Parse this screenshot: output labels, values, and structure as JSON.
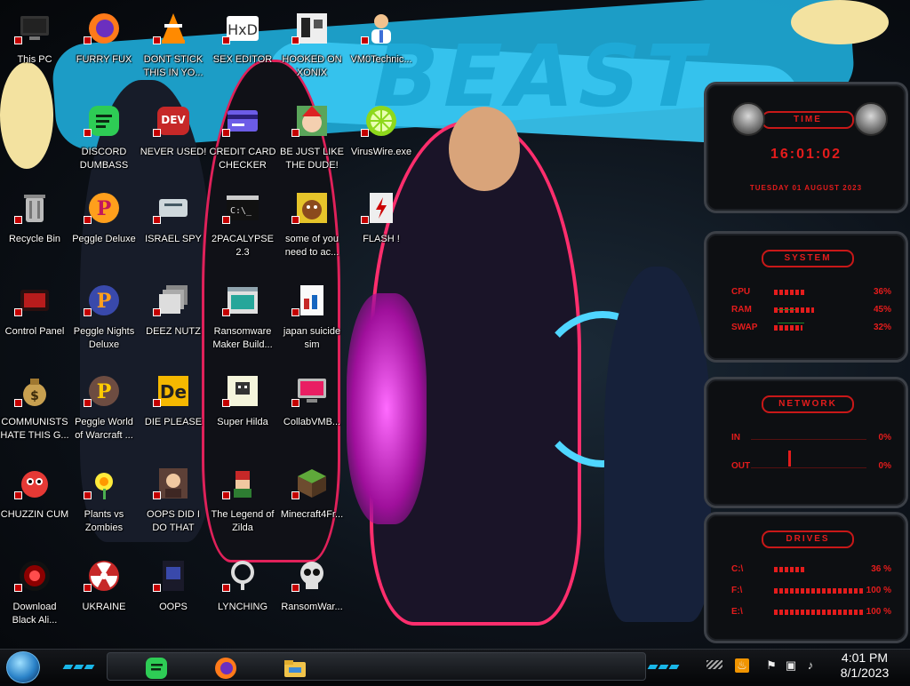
{
  "wallpaper": {
    "title": "BEAST"
  },
  "desktop": {
    "icons": [
      {
        "label": "This PC",
        "icon": "computer-icon"
      },
      {
        "label": "FURRY FUX",
        "icon": "firefox-icon"
      },
      {
        "label": "DONT STICK THIS IN YO...",
        "icon": "vlc-cone-icon"
      },
      {
        "label": "SEX EDITOR",
        "icon": "hex-editor-icon"
      },
      {
        "label": "HOOKED ON XONIX",
        "icon": "xonix-game-icon"
      },
      {
        "label": "VM0Technic...",
        "icon": "doctor-person-icon"
      },
      {
        "label": "DISCORD DUMBASS",
        "icon": "green-chat-icon"
      },
      {
        "label": "NEVER USED!",
        "icon": "dev-cpp-icon"
      },
      {
        "label": "CREDIT CARD CHECKER",
        "icon": "credit-card-icon"
      },
      {
        "label": "BE JUST LIKE THE DUDE!",
        "icon": "santa-face-icon"
      },
      {
        "label": "VirusWire.exe",
        "icon": "lime-slice-icon"
      },
      {
        "label": "Recycle Bin",
        "icon": "recycle-bin-icon"
      },
      {
        "label": "Peggle Deluxe",
        "icon": "peggle-icon"
      },
      {
        "label": "ISRAEL SPY",
        "icon": "card-reader-icon"
      },
      {
        "label": "2PACALYPSE 2.3",
        "icon": "terminal-window-icon"
      },
      {
        "label": "some of you need to ac...",
        "icon": "beaver-icon"
      },
      {
        "label": "FLASH !",
        "icon": "flash-document-icon"
      },
      {
        "label": "Control Panel",
        "icon": "control-panel-icon"
      },
      {
        "label": "Peggle Nights Deluxe",
        "icon": "peggle-nights-icon"
      },
      {
        "label": "DEEZ NUTZ",
        "icon": "stacked-windows-icon"
      },
      {
        "label": "Ransomware Maker Build...",
        "icon": "app-window-icon"
      },
      {
        "label": "japan suicide sim",
        "icon": "installer-document-icon"
      },
      {
        "label": "COMMUNISTS HATE THIS G...",
        "icon": "money-bag-icon"
      },
      {
        "label": "Peggle World of Warcraft ...",
        "icon": "peggle-wow-icon"
      },
      {
        "label": "DIE PLEASE",
        "icon": "de-letters-icon"
      },
      {
        "label": "Super Hilda",
        "icon": "pixel-character-icon"
      },
      {
        "label": "CollabVMB...",
        "icon": "monitor-app-icon"
      },
      {
        "label": "CHUZZIN CUM",
        "icon": "red-chuzzle-icon"
      },
      {
        "label": "Plants vs Zombies",
        "icon": "flower-icon"
      },
      {
        "label": "OOPS DID I DO THAT",
        "icon": "portrait-painting-icon"
      },
      {
        "label": "The Legend of Zilda",
        "icon": "pixel-hero-icon"
      },
      {
        "label": "Minecraft4Fr...",
        "icon": "grass-block-icon"
      },
      {
        "label": "Download Black Ali...",
        "icon": "black-orb-icon"
      },
      {
        "label": "UKRAINE",
        "icon": "radiation-icon"
      },
      {
        "label": "OOPS",
        "icon": "dark-document-icon"
      },
      {
        "label": "LYNCHING",
        "icon": "rope-knot-icon"
      },
      {
        "label": "RansomWar...",
        "icon": "skull-icon"
      }
    ]
  },
  "widget": {
    "time": {
      "title": "TIME",
      "clock": "16:01:02",
      "date": "TUESDAY 01 AUGUST 2023"
    },
    "system": {
      "title": "SYSTEM",
      "rows": [
        {
          "label": "CPU",
          "value": "36%",
          "level": 0.36
        },
        {
          "label": "RAM",
          "value": "45%",
          "level": 0.45
        },
        {
          "label": "SWAP",
          "value": "32%",
          "level": 0.32
        }
      ]
    },
    "network": {
      "title": "NETWORK",
      "rows": [
        {
          "label": "IN",
          "value": "0%"
        },
        {
          "label": "OUT",
          "value": "0%"
        }
      ]
    },
    "drives": {
      "title": "DRIVES",
      "rows": [
        {
          "label": "C:\\",
          "value": "36 %",
          "level": 0.36
        },
        {
          "label": "F:\\",
          "value": "100 %",
          "level": 1.0
        },
        {
          "label": "E:\\",
          "value": "100 %",
          "level": 1.0
        }
      ]
    }
  },
  "taskbar": {
    "pinned": [
      {
        "icon": "green-chat-icon"
      },
      {
        "icon": "firefox-icon"
      },
      {
        "icon": "file-explorer-icon"
      }
    ],
    "tray": [
      {
        "icon": "java-icon"
      },
      {
        "icon": "flag-error-icon"
      },
      {
        "icon": "network-icon"
      },
      {
        "icon": "speaker-icon"
      }
    ],
    "clock": {
      "time": "4:01 PM",
      "date": "8/1/2023"
    }
  },
  "colors": {
    "accent": "#1ea9d6",
    "widget_red": "#e41c1c",
    "taskbar": "#0b0c0e"
  }
}
